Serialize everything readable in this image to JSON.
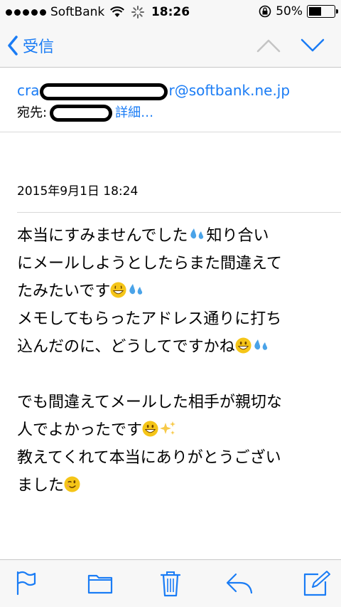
{
  "status": {
    "carrier": "SoftBank",
    "time": "18:26",
    "battery_text": "50%",
    "battery_level": 0.5
  },
  "nav": {
    "back_label": "受信"
  },
  "header": {
    "from_prefix": "cra",
    "from_suffix": "r@softbank.ne.jp",
    "to_label": "宛先:",
    "details_label": "詳細…"
  },
  "date": "2015年9月1日 18:24",
  "body": {
    "l1": "本当にすみませんでした",
    "l1b": "知り合い",
    "l2": "にメールしようとしたらまた間違えて",
    "l3": "たみたいです",
    "l4": "メモしてもらったアドレス通りに打ち",
    "l5": "込んだのに、どうしてですかね",
    "l6": "でも間違えてメールした相手が親切な",
    "l7": "人でよかったです",
    "l8": "教えてくれて本当にありがとうござい",
    "l9": "ました"
  },
  "colors": {
    "accent": "#1a7cf5"
  },
  "icons": [
    "signal-dots-icon",
    "wifi-icon",
    "activity-spinner-icon",
    "rotation-lock-icon",
    "battery-icon",
    "chevron-left-icon",
    "chevron-up-icon",
    "chevron-down-icon",
    "flag-icon",
    "folder-icon",
    "trash-icon",
    "reply-icon",
    "compose-icon"
  ]
}
